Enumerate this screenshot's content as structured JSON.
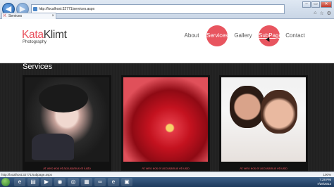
{
  "browser": {
    "address": "http://localhost:32771/services.aspx",
    "tab_label": "Services",
    "window_buttons": [
      "–",
      "▭",
      "✕"
    ],
    "toolbar_icons": [
      "home-icon",
      "star-icon",
      "gear-icon"
    ]
  },
  "site": {
    "logo_part1": "Kata",
    "logo_part2": "Klimt",
    "logo_sub": "Photography",
    "nav": [
      {
        "label": "About"
      },
      {
        "label": "Services",
        "state": "active"
      },
      {
        "label": "Gallery"
      },
      {
        "label": "SubPage",
        "state": "hover"
      },
      {
        "label": "Contact"
      }
    ],
    "accent_color": "#e8555f"
  },
  "main": {
    "section_title": "Services",
    "cards": [
      {
        "caption": "At vero eos et accusamus et iusto",
        "image": "woman-with-hat"
      },
      {
        "caption": "At vero eos et accusamus et iusto",
        "image": "red-flower"
      },
      {
        "caption": "At vero eos et accusamus et iusto",
        "image": "couple"
      }
    ]
  },
  "status": {
    "url": "http://localhost:32771/subpage.aspx",
    "zoom": "100%"
  },
  "taskbar": {
    "apps": [
      "ie-icon",
      "folder-icon",
      "media-icon",
      "firefox-icon",
      "chrome-icon",
      "explorer-icon",
      "vs-icon",
      "ie-icon",
      "photos-icon"
    ],
    "time": "7:28 PM",
    "date": "7/28/2013"
  }
}
